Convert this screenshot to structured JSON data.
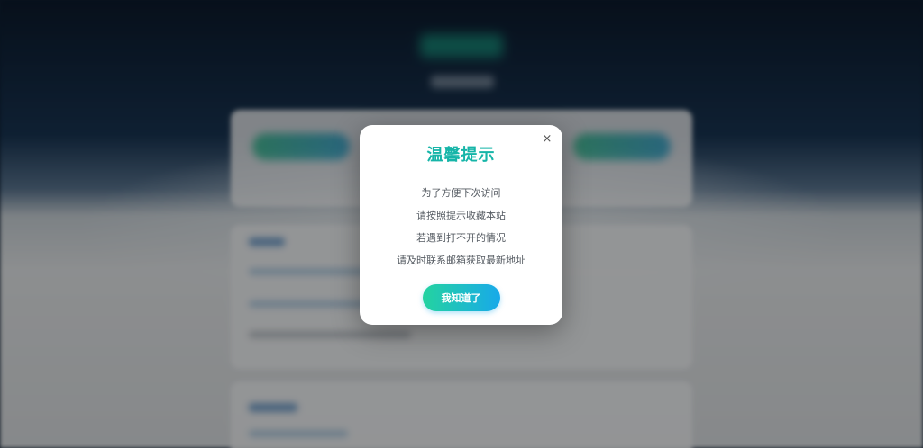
{
  "dialog": {
    "title": "温馨提示",
    "close_symbol": "×",
    "lines": [
      "为了方便下次访问",
      "请按照提示收藏本站",
      "若遇到打不开的情况",
      "请及时联系邮箱获取最新地址"
    ],
    "confirm_label": "我知道了"
  },
  "colors": {
    "title": "#16b5a8",
    "button_gradient_start": "#24d3a0",
    "button_gradient_end": "#18a9ea",
    "overlay": "rgba(0,0,0,0.38)"
  },
  "icons": {
    "close": "close-icon"
  }
}
